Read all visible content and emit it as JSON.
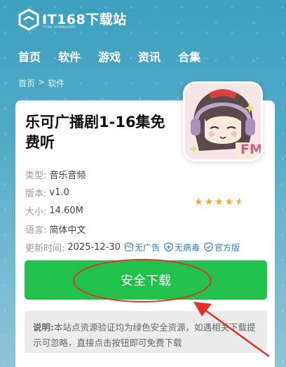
{
  "logo": {
    "text": "IT168下载站",
    "subtitle": "IT168 DOWNLOADS"
  },
  "nav": {
    "items": [
      "首页",
      "软件",
      "游戏",
      "资讯",
      "合集"
    ]
  },
  "breadcrumb": {
    "home": "首页",
    "separator": ">",
    "current": "软件"
  },
  "app": {
    "title": "乐可广播剧1-16集免费听",
    "icon_badge": "FM",
    "rating_stars": 4.5,
    "meta": [
      {
        "label": "类型:",
        "value": "音乐音频"
      },
      {
        "label": "版本:",
        "value": "v1.0"
      },
      {
        "label": "大小:",
        "value": "14.60M"
      },
      {
        "label": "语言:",
        "value": "简体中文"
      }
    ],
    "update_label": "更新时间:",
    "update_value": "2025-12-30",
    "badges": [
      {
        "icon": "ad-icon",
        "label": "无广告"
      },
      {
        "icon": "shield-plus-icon",
        "label": "无病毒"
      },
      {
        "icon": "shield-check-icon",
        "label": "官方版"
      }
    ]
  },
  "download": {
    "label": "安全下载"
  },
  "note": {
    "prefix": "说明:",
    "text": "本站点资源验证均为绿色安全资源，如遇相关下载提示可忽略，直接点击按钮即可免费下载"
  },
  "colors": {
    "header_bg": "#4fa7c3",
    "download_green": "#22c14b",
    "annotation_red": "#e3312a",
    "star": "#f2a92b",
    "badge_blue": "#2f7fc4"
  }
}
